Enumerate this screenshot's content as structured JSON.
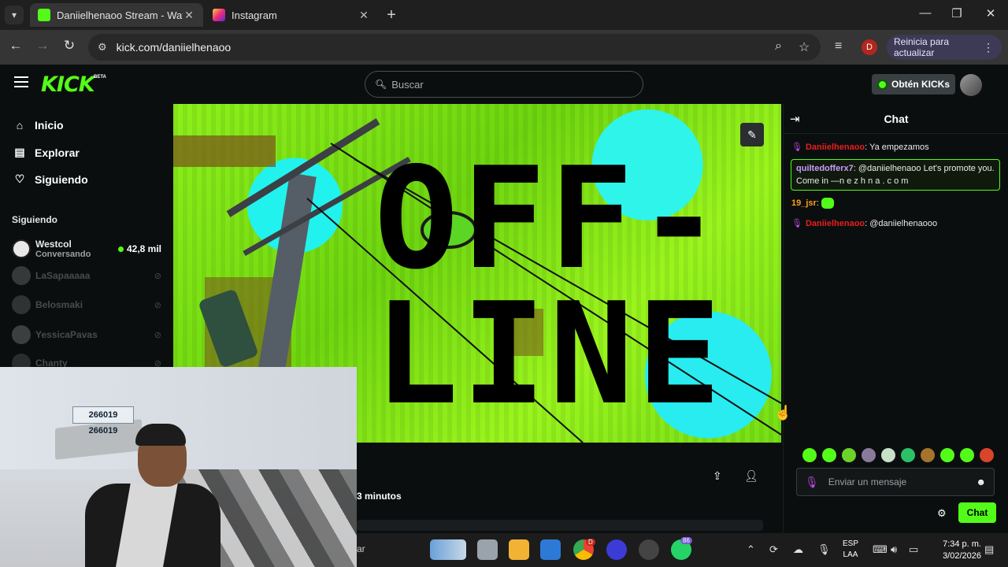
{
  "browser": {
    "tabs": [
      {
        "title": "Daniielhenaoo Stream - Watch",
        "favicon": "kick-icon",
        "active": true
      },
      {
        "title": "Instagram",
        "favicon": "instagram-icon",
        "active": false
      }
    ],
    "url": "kick.com/daniielhenaoo",
    "profile_initial": "D",
    "update_label": "Reinicia para actualizar"
  },
  "kick": {
    "logo": "KICK",
    "logo_badge": "BETA",
    "search_placeholder": "Buscar",
    "get_kicks_label": "Obtén KICKs",
    "nav": [
      {
        "label": "Inicio",
        "icon": "home-icon"
      },
      {
        "label": "Explorar",
        "icon": "explore-icon"
      },
      {
        "label": "Siguiendo",
        "icon": "heart-icon"
      }
    ],
    "following_section": "Siguiendo",
    "following": [
      {
        "name": "Westcol",
        "sub": "Conversando",
        "viewers": "42,8 mil",
        "live": true
      },
      {
        "name": "LaSapaaaaa",
        "live": false
      },
      {
        "name": "Belosmaki",
        "live": false
      },
      {
        "name": "YessicaPavas",
        "live": false
      },
      {
        "name": "Chanty",
        "live": false
      }
    ]
  },
  "video": {
    "offline_line1": "OFF-",
    "offline_line2": "LINE",
    "edit_icon": "pencil-icon"
  },
  "stream_info": {
    "duration_tail": "3 minutos"
  },
  "chat": {
    "title": "Chat",
    "messages": [
      {
        "user": "Daniielhenaoo",
        "text": ": Ya empezamos",
        "color": "#e91e1e",
        "mic": true
      },
      {
        "user": "quiltedofferx7",
        "text": ": @daniielhenaoo Let's promote you. Come in  —n e z h n a . c o m",
        "color": "#c99bff",
        "highlight": true
      },
      {
        "user": "19_jsr",
        "text": ": ",
        "color": "#ff9f1a",
        "emote": true
      },
      {
        "user": "Daniielhenaoo",
        "text": ": @daniielhenaooo",
        "color": "#e91e1e",
        "mic": true
      }
    ],
    "input_placeholder": "Enviar un mensaje",
    "send_label": "Chat"
  },
  "webcam": {
    "plate_text": "266019 266019"
  },
  "taskbar": {
    "search_tail": "ar",
    "whatsapp_badge": "86",
    "chrome_badge": "D",
    "lang_line1": "ESP",
    "lang_line2": "LAA",
    "time": "7:34 p. m.",
    "date": "3/02/2026"
  }
}
